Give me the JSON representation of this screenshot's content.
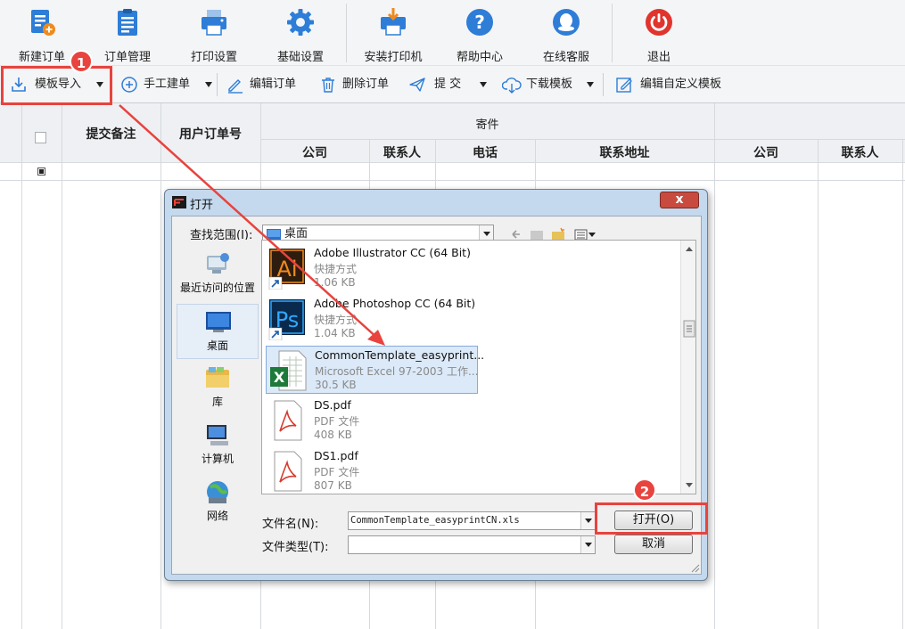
{
  "top_toolbar": {
    "items": [
      {
        "label": "新建订单",
        "icon": "new-order-icon"
      },
      {
        "label": "订单管理",
        "icon": "clipboard-icon"
      },
      {
        "label": "打印设置",
        "icon": "printer-icon"
      },
      {
        "label": "基础设置",
        "icon": "gear-icon"
      },
      {
        "label": "安装打印机",
        "icon": "printer-install-icon"
      },
      {
        "label": "帮助中心",
        "icon": "help-icon"
      },
      {
        "label": "在线客服",
        "icon": "chat-icon"
      },
      {
        "label": "退出",
        "icon": "power-icon"
      }
    ]
  },
  "toolbar2": {
    "template_import": "模板导入",
    "manual_create": "手工建单",
    "edit_order": "编辑订单",
    "delete_order": "删除订单",
    "submit": "提 交",
    "download_template": "下载模板",
    "edit_custom_template": "编辑自定义模板"
  },
  "grid": {
    "col_remark": "提交备注",
    "col_user_order_no": "用户订单号",
    "group_sender": "寄件",
    "sub_company": "公司",
    "sub_contact": "联系人",
    "sub_phone": "电话",
    "sub_address": "联系地址",
    "sub_company2": "公司",
    "sub_contact2": "联系人"
  },
  "annotations": {
    "step1": "1",
    "step2": "2"
  },
  "dialog": {
    "title": "打开",
    "close": "x",
    "look_in_label": "查找范围(I):",
    "look_in_value": "桌面",
    "places": [
      {
        "label": "最近访问的位置",
        "icon": "recent-places-icon"
      },
      {
        "label": "桌面",
        "icon": "desktop-icon"
      },
      {
        "label": "库",
        "icon": "library-icon"
      },
      {
        "label": "计算机",
        "icon": "computer-icon"
      },
      {
        "label": "网络",
        "icon": "network-icon"
      }
    ],
    "files": [
      {
        "name": "Adobe Illustrator CC (64 Bit)",
        "type": "快捷方式",
        "size": "1.06 KB",
        "icon": "illustrator-icon"
      },
      {
        "name": "Adobe Photoshop CC (64 Bit)",
        "type": "快捷方式",
        "size": "1.04 KB",
        "icon": "photoshop-icon"
      },
      {
        "name": "CommonTemplate_easyprint...",
        "type": "Microsoft Excel 97-2003 工作...",
        "size": "30.5 KB",
        "icon": "excel-icon"
      },
      {
        "name": "DS.pdf",
        "type": "PDF 文件",
        "size": "408 KB",
        "icon": "pdf-icon"
      },
      {
        "name": "DS1.pdf",
        "type": "PDF 文件",
        "size": "807 KB",
        "icon": "pdf-icon"
      }
    ],
    "filename_label": "文件名(N):",
    "filename_value": "CommonTemplate_easyprintCN.xls",
    "filetype_label": "文件类型(T):",
    "filetype_value": "",
    "open_button": "打开(O)",
    "cancel_button": "取消"
  }
}
